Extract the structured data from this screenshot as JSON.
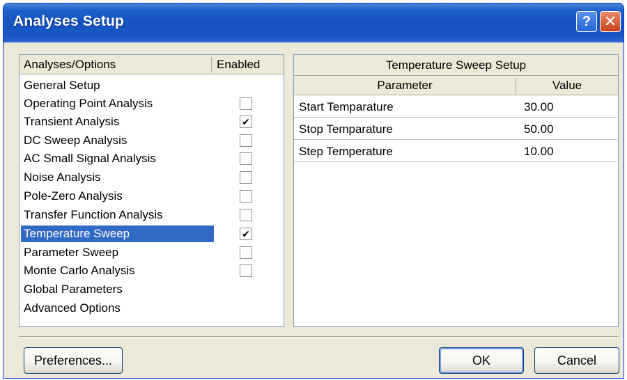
{
  "window": {
    "title": "Analyses Setup",
    "help_label": "?",
    "close_label": "✕"
  },
  "options_list": {
    "header_name": "Analyses/Options",
    "header_enabled": "Enabled",
    "selected_item": "Temperature Sweep",
    "items": [
      {
        "label": "General Setup",
        "enabled": null
      },
      {
        "label": "Operating Point Analysis",
        "enabled": false
      },
      {
        "label": "Transient Analysis",
        "enabled": true
      },
      {
        "label": "DC Sweep Analysis",
        "enabled": false
      },
      {
        "label": "AC Small Signal Analysis",
        "enabled": false
      },
      {
        "label": "Noise Analysis",
        "enabled": false
      },
      {
        "label": "Pole-Zero Analysis",
        "enabled": false
      },
      {
        "label": "Transfer Function Analysis",
        "enabled": false
      },
      {
        "label": "Temperature Sweep",
        "enabled": true
      },
      {
        "label": "Parameter Sweep",
        "enabled": false
      },
      {
        "label": "Monte Carlo Analysis",
        "enabled": false
      },
      {
        "label": "Global Parameters",
        "enabled": null
      },
      {
        "label": "Advanced Options",
        "enabled": null
      }
    ]
  },
  "setup_panel": {
    "title": "Temperature Sweep Setup",
    "col_parameter": "Parameter",
    "col_value": "Value",
    "rows": [
      {
        "parameter": "Start Temparature",
        "value": "30.00"
      },
      {
        "parameter": "Stop Temparature",
        "value": "50.00"
      },
      {
        "parameter": "Step Temperature",
        "value": "10.00"
      }
    ]
  },
  "footer": {
    "preferences_label": "Preferences...",
    "ok_label": "OK",
    "cancel_label": "Cancel"
  },
  "colors": {
    "titlebar": "#1553c0",
    "selection": "#316ac5",
    "dialog_bg": "#ece9d8",
    "close_button": "#c8411c"
  },
  "icons": {
    "checkmark": "checkmark-icon",
    "help": "help-icon",
    "close": "close-icon"
  }
}
